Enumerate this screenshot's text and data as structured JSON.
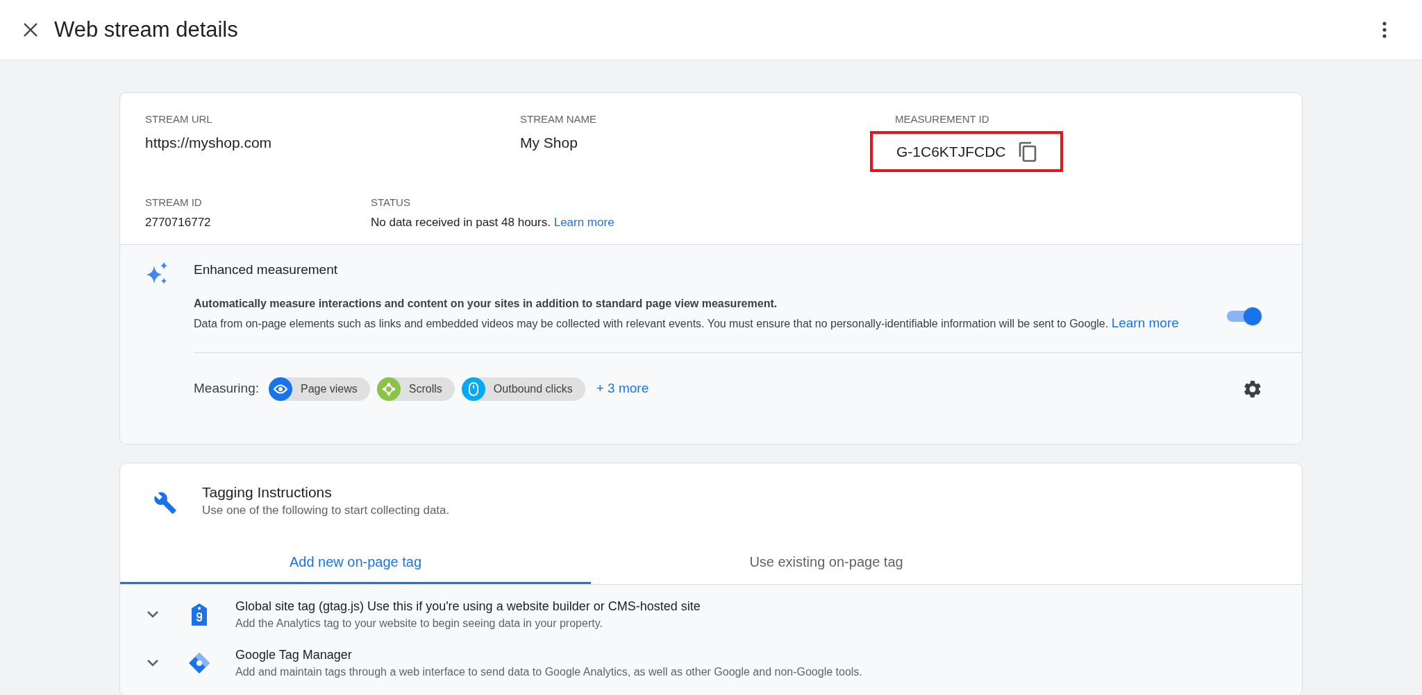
{
  "header": {
    "title": "Web stream details"
  },
  "stream": {
    "fields": [
      {
        "label": "STREAM URL",
        "value": "https://myshop.com"
      },
      {
        "label": "STREAM NAME",
        "value": "My Shop"
      },
      {
        "label": "MEASUREMENT ID",
        "value": "G-1C6KTJFCDC",
        "highlighted": true
      }
    ],
    "stream_id": {
      "label": "STREAM ID",
      "value": "2770716772"
    },
    "status": {
      "label": "STATUS",
      "text": "No data received in past 48 hours.",
      "link": "Learn more"
    }
  },
  "enhanced_measurement": {
    "title": "Enhanced measurement",
    "on": true,
    "summary": "Automatically measure interactions and content on your sites in addition to standard page view measurement.",
    "description": "Data from on-page elements such as links and embedded videos may be collected with relevant events. You must ensure that no personally-identifiable information will be sent to Google.",
    "link": "Learn more",
    "measuring_label": "Measuring:",
    "chips": [
      {
        "label": "Page views",
        "kind": "eye",
        "color": "#1a73e8"
      },
      {
        "label": "Scrolls",
        "kind": "scroll",
        "color": "#8bc34a"
      },
      {
        "label": "Outbound clicks",
        "kind": "mouse",
        "color": "#03a9f4"
      }
    ],
    "more": "+ 3 more"
  },
  "tagging": {
    "title": "Tagging Instructions",
    "subtitle": "Use one of the following to start collecting data.",
    "tabs": [
      {
        "label": "Add new on-page tag",
        "selected": true
      },
      {
        "label": "Use existing on-page tag",
        "selected": false
      }
    ],
    "options": [
      {
        "kind": "gtag",
        "title": "Global site tag (gtag.js)",
        "note": "Use this if you're using a website builder or CMS-hosted site",
        "description": "Add the Analytics tag to your website to begin seeing data in your property.",
        "expanded": false
      },
      {
        "kind": "gtm",
        "title": "Google Tag Manager",
        "description": "Add and maintain tags through a web interface to send data to Google Analytics, as well as other Google and non-Google tools.",
        "expanded": false
      }
    ]
  }
}
